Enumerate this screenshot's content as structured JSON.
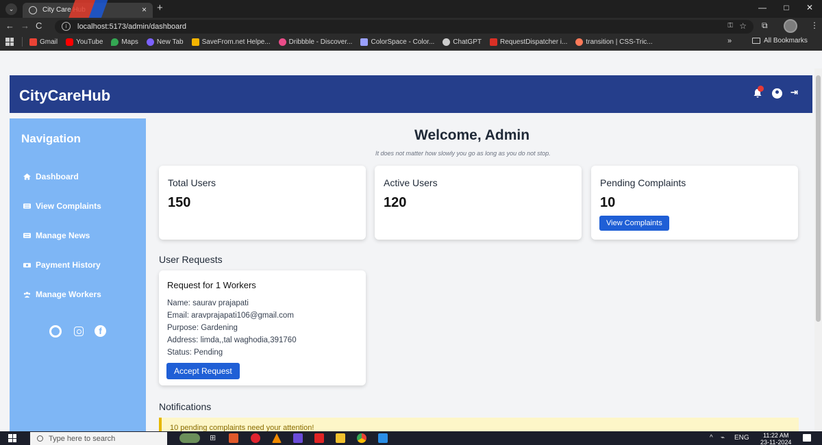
{
  "browser": {
    "tab_title": "City Care Hub",
    "url": "localhost:5173/admin/dashboard",
    "bookmarks": [
      "Gmail",
      "YouTube",
      "Maps",
      "New Tab",
      "SaveFrom.net Helpe...",
      "Dribbble - Discover...",
      "ColorSpace - Color...",
      "ChatGPT",
      "RequestDispatcher i...",
      "transition | CSS-Tric..."
    ],
    "all_bookmarks": "All Bookmarks",
    "more": "»"
  },
  "header": {
    "brand": "CityCareHub",
    "accent_color": "#253e8b"
  },
  "sidebar": {
    "title": "Navigation",
    "items": [
      {
        "label": "Dashboard",
        "icon": "home-icon"
      },
      {
        "label": "View Complaints",
        "icon": "list-icon"
      },
      {
        "label": "Manage News",
        "icon": "news-icon"
      },
      {
        "label": "Payment History",
        "icon": "money-icon"
      },
      {
        "label": "Manage Workers",
        "icon": "users-icon"
      }
    ],
    "social_icons": [
      "github-icon",
      "instagram-icon",
      "facebook-icon"
    ],
    "color": "#7eb6f5"
  },
  "main": {
    "welcome": "Welcome, Admin",
    "quote": "It does not matter how slowly you go as long as you do not stop.",
    "stats": [
      {
        "label": "Total Users",
        "value": "150"
      },
      {
        "label": "Active Users",
        "value": "120"
      },
      {
        "label": "Pending Complaints",
        "value": "10",
        "button": "View Complaints"
      }
    ],
    "requests_title": "User Requests",
    "request": {
      "title": "Request for 1 Workers",
      "name": "Name: saurav prajapati",
      "email": "Email: aravprajapati106@gmail.com",
      "purpose": "Purpose: Gardening",
      "address": "Address: limda,,tal waghodia,391760",
      "status": "Status: Pending",
      "button": "Accept Request"
    },
    "notifications_title": "Notifications",
    "notification_text": "10 pending complaints need your attention!"
  },
  "taskbar": {
    "search_placeholder": "Type here to search",
    "lang": "ENG",
    "time": "11:22 AM",
    "date": "23-11-2024"
  }
}
